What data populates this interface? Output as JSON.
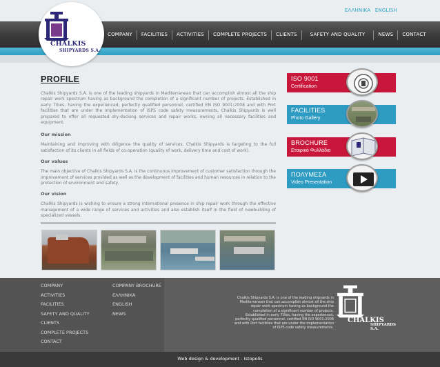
{
  "header": {
    "languages": [
      "ΕΛΛΗΝΙΚΑ",
      "ENGLISH"
    ],
    "logo": {
      "line1": "CHALKIS",
      "line2": "SHIPYARDS S.A."
    },
    "nav": [
      "COMPANY",
      "FACILITIES",
      "ACTIVITIES",
      "COMPLETE PROJECTS",
      "CLIENTS",
      "SAFETY AND QUALITY",
      "NEWS",
      "CONTACT"
    ]
  },
  "main": {
    "title": "PROFILE",
    "intro": "Chalkis Shipyards S.A. is one of the leading shipyards in Mediterranean that can accomplish almost all the ship repair work spectrum having as background the completion of a significant number of projects. Established in early 70ies, having the experienced, perfectly qualified personnel, certified EN ISO 9001:2008 and with Port facilities that are under the implementation of ISPS code safety measurements, Chalkis Shipyards is well prepared to offer all requested dry-docking services and repair works, owning all necessary facilities and equipment.",
    "mission_heading": "Our mission",
    "mission": "Maintaining and improving with diligence the quality of services, Chalkis Shipyards is targeting to the full satisfaction of its clients in all fields of co-operation (quality of work, delivery time and cost of work).",
    "values_heading": "Our values",
    "values": "The main objective of Chalkis Shipyards S.A. is the continuous improvement of customer satisfaction through the improvement of services provided as well as the development of facilities and human resources in relation to the protection of environment and safety.",
    "vision_heading": "Our vision",
    "vision": "Chalkis Shipyards is wishing to ensure a strong international presence in ship repair work through the effective management of a wide range of services and activities and also establish itself in the field of newbuilding of specialized vessels."
  },
  "sidebar": {
    "banners": [
      {
        "line1": "ISO 9001",
        "line2": "Certification"
      },
      {
        "line1": "FACILITIES",
        "line2": "Photo Gallery"
      },
      {
        "line1": "BROCHURE",
        "line2": "Εταιρικό Φυλλάδιο"
      },
      {
        "line1": "ΠΟΛΥΜΕΣΑ",
        "line2": "Video Presentation"
      }
    ]
  },
  "footer": {
    "col1": [
      "COMPANY",
      "ACTIVITIES",
      "FACILITIES",
      "SAFETY AND QUALITY",
      "CLIENTS",
      "COMPLETE PROJECTS",
      "CONTACT"
    ],
    "col2": [
      "COMPANY BROCHURE",
      "ΕΛΛΗΝΙΚΑ",
      "ENGLISH",
      "NEWS"
    ],
    "about": "Chalkis Shipyards S.A. is one of the leading shipyards in Mediterranean that can accomplish almost all the ship repair work spectrum having as background the completion of a significant number of projects. Established in early 70ies, having the experienced, perfectly qualified personnel, certified EN ISO 9001:2008 and with Port facilities that are under the implementation of ISPS code safety measurements.",
    "logo": {
      "line1": "CHALKIS",
      "line2": "SHIPYARDS S.A."
    },
    "credit": "Web design & development - Istopolis"
  },
  "colors": {
    "accent_blue": "#2d9bc2",
    "accent_red": "#c8173a",
    "logo_navy": "#2b2675"
  }
}
